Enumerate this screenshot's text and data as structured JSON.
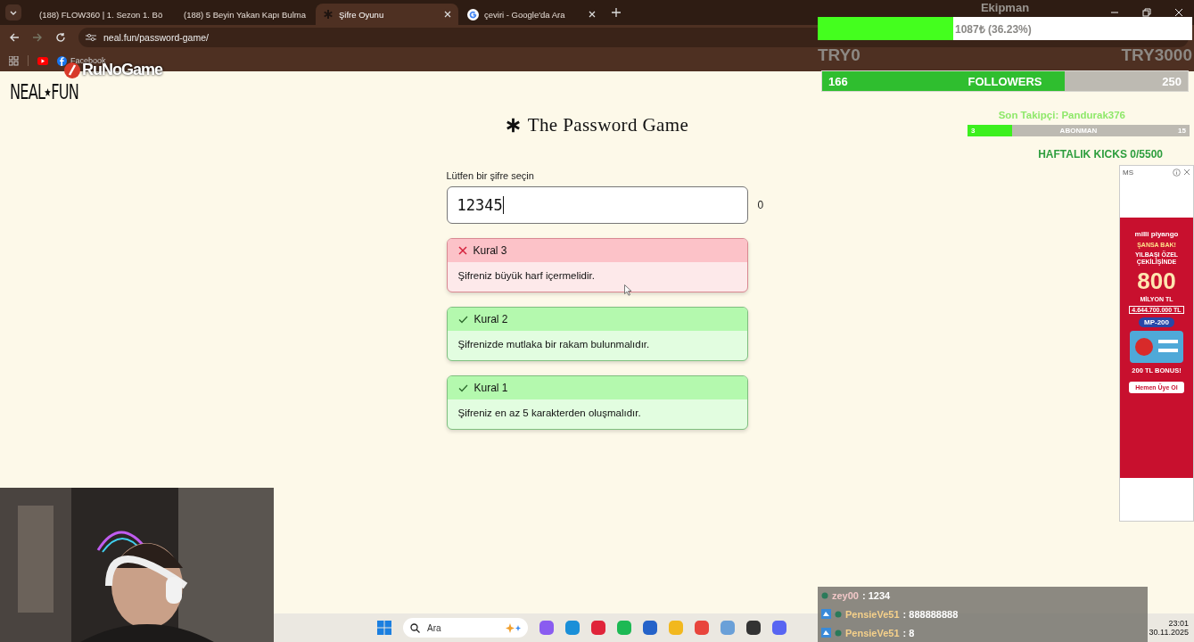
{
  "browser": {
    "tabs": [
      {
        "kind": "youtube",
        "title": "(188) FLOW360 | 1. Sezon 1. Bö",
        "selected": false
      },
      {
        "kind": "youtube",
        "title": "(188) 5 Beyin Yakan Kapı Bulma",
        "selected": false
      },
      {
        "kind": "game",
        "title": "Şifre Oyunu",
        "selected": true
      },
      {
        "kind": "google",
        "title": "çeviri - Google'da Ara",
        "selected": false
      }
    ],
    "address": "neal.fun/password-game/",
    "bookmarks": [
      {
        "kind": "youtube"
      },
      {
        "kind": "facebook",
        "label": "Facebook"
      }
    ]
  },
  "page": {
    "logo_left": "NEAL",
    "logo_right": "FUN",
    "title": "The Password Game",
    "field_label": "Lütfen bir şifre seçin",
    "password": "12345",
    "length": "0",
    "rules": [
      {
        "title": "Kural 3",
        "text": "Şifreniz büyük harf içermelidir.",
        "passed": false
      },
      {
        "title": "Kural 2",
        "text": "Şifrenizde mutlaka bir rakam bulunmalıdır.",
        "passed": true
      },
      {
        "title": "Kural 1",
        "text": "Şifreniz en az 5 karakterden oluşmalıdır.",
        "passed": true
      }
    ]
  },
  "stream_logo": "RuNoGame",
  "overlay": {
    "title": "Ekipman",
    "goal": {
      "reading": "1087₺ (36.23%)",
      "level": 0.3623,
      "min": "TRY0",
      "max": "TRY3000"
    },
    "followers": {
      "current": "166",
      "label": "FOLLOWERS",
      "target": "250",
      "level": 0.664
    },
    "last_follower": "Son Takipçi: Pandurak376",
    "subs": {
      "current": "3",
      "label": "ABONMAN",
      "target": "15",
      "level": 0.2
    },
    "kicks": "HAFTALIK KICKS 0/5500"
  },
  "ad": {
    "sponsor": "MS",
    "brand": "milli piyango",
    "headline": "ŞANSA BAK!",
    "subline": "YILBAŞI ÖZEL ÇEKİLİŞİNDE",
    "amount": "800",
    "unit": "MİLYON TL",
    "total": "4.644.700.000 TL",
    "badge": "MP-200",
    "bonus": "200 TL BONUS!",
    "cta": "Hemen Üye Ol"
  },
  "taskbar": {
    "search": "Ara",
    "apps": [
      {
        "color": "#8a5cf0"
      },
      {
        "color": "#1a8fd8"
      },
      {
        "color": "#e0243a"
      },
      {
        "color": "#1db954"
      },
      {
        "color": "#2563c9"
      },
      {
        "color": "#f2b81e"
      },
      {
        "color": "#e8453c"
      },
      {
        "color": "#6aa0d8"
      },
      {
        "color": "#333333"
      },
      {
        "color": "#5865f2"
      }
    ],
    "time": "23:01",
    "date": "30.11.2025"
  },
  "chat": [
    {
      "user": "zey00",
      "message": ": 1234",
      "badge": false
    },
    {
      "user": "PensieVe51",
      "message": ": 888888888",
      "badge": true
    },
    {
      "user": "PensieVe51",
      "message": ": 8",
      "badge": true
    }
  ]
}
